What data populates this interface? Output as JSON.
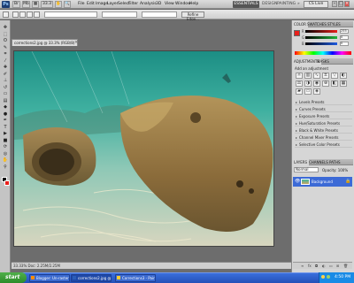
{
  "app": {
    "logo_text": "Ps",
    "menus": [
      "File",
      "Edit",
      "Image",
      "Layer",
      "Select",
      "Filter",
      "Analysis",
      "3D",
      "View",
      "Window",
      "Help"
    ],
    "zoom_value": "33.3"
  },
  "workspace": {
    "essentials_label": "ESSENTIALS",
    "design_label": "DESIGN",
    "painting_label": "PAINTING",
    "more_label": "»",
    "cs_live_label": "CS Live"
  },
  "options": {
    "refine_label": "Refine Edge..."
  },
  "document": {
    "tab_title": "corrections2.jpg @ 33.3% (RGB/8)",
    "tab_close": "×",
    "status_text": "33.33%   Doc: 2.25M/2.25M"
  },
  "panels": {
    "color_tabs": [
      "COLOR",
      "SWATCHES",
      "STYLES"
    ],
    "color_sliders": [
      {
        "label": "R",
        "value": "255",
        "gradient": "#e8201c"
      },
      {
        "label": "G",
        "value": "0",
        "gradient": "#1fb33a"
      },
      {
        "label": "B",
        "value": "0",
        "gradient": "#1e5be0"
      }
    ],
    "adjust_tabs": [
      "ADJUSTMENTS",
      "MASKS"
    ],
    "adjust_heading": "Add an adjustment",
    "presets": [
      "Levels Presets",
      "Curves Presets",
      "Exposure Presets",
      "Hue/Saturation Presets",
      "Black & White Presets",
      "Channel Mixer Presets",
      "Selective Color Presets"
    ],
    "layer_tabs": [
      "LAYERS",
      "CHANNELS",
      "PATHS"
    ],
    "blend_mode": "Normal",
    "opacity_label": "Opacity: 100%",
    "layer_name": "Background"
  },
  "taskbar": {
    "start_label": "start",
    "tasks": [
      "Blogger: Un-rasterin...",
      "corrections2.jpg @...",
      "Corrections3 - Paint"
    ],
    "clock": "4:50 PM"
  },
  "colors": {
    "accent": "#3c6ad6",
    "foreground_swatch": "#000000",
    "background_swatch": "#e8201c",
    "taskbar": "#2450b8"
  }
}
